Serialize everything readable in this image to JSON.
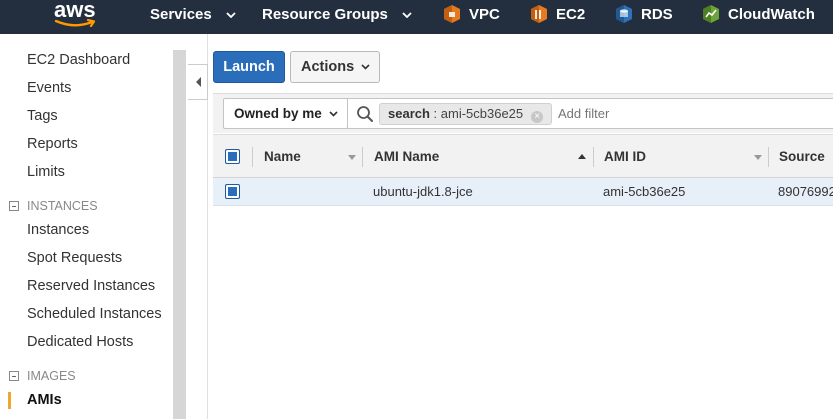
{
  "topnav": {
    "logo": "aws",
    "services": "Services",
    "resource_groups": "Resource Groups",
    "pinned": [
      {
        "label": "VPC",
        "icon": "vpc-icon",
        "color": "#e57a1f"
      },
      {
        "label": "EC2",
        "icon": "ec2-icon",
        "color": "#e57a1f"
      },
      {
        "label": "RDS",
        "icon": "rds-icon",
        "color": "#2e73b8"
      },
      {
        "label": "CloudWatch",
        "icon": "cloudwatch-icon",
        "color": "#6ca43a"
      }
    ]
  },
  "sidebar": {
    "items_top": [
      "EC2 Dashboard",
      "Events",
      "Tags",
      "Reports",
      "Limits"
    ],
    "section_instances": "INSTANCES",
    "items_instances": [
      "Instances",
      "Spot Requests",
      "Reserved Instances",
      "Scheduled Instances",
      "Dedicated Hosts"
    ],
    "section_images": "IMAGES",
    "active_item": "AMIs"
  },
  "toolbar": {
    "launch_label": "Launch",
    "actions_label": "Actions"
  },
  "filter": {
    "owned_by": "Owned by me",
    "token_key": "search",
    "token_value": " : ami-5cb36e25",
    "placeholder": "Add filter"
  },
  "table": {
    "columns": [
      "Name",
      "AMI Name",
      "AMI ID",
      "Source"
    ],
    "rows": [
      {
        "name": "",
        "ami_name": "ubuntu-jdk1.8-jce",
        "ami_id": "ami-5cb36e25",
        "source": "89076992"
      }
    ]
  },
  "colors": {
    "nav_bg": "#232f3e",
    "primary": "#2a6ebb",
    "active_accent": "#f0a82c",
    "row_selected": "#e7eff9"
  }
}
